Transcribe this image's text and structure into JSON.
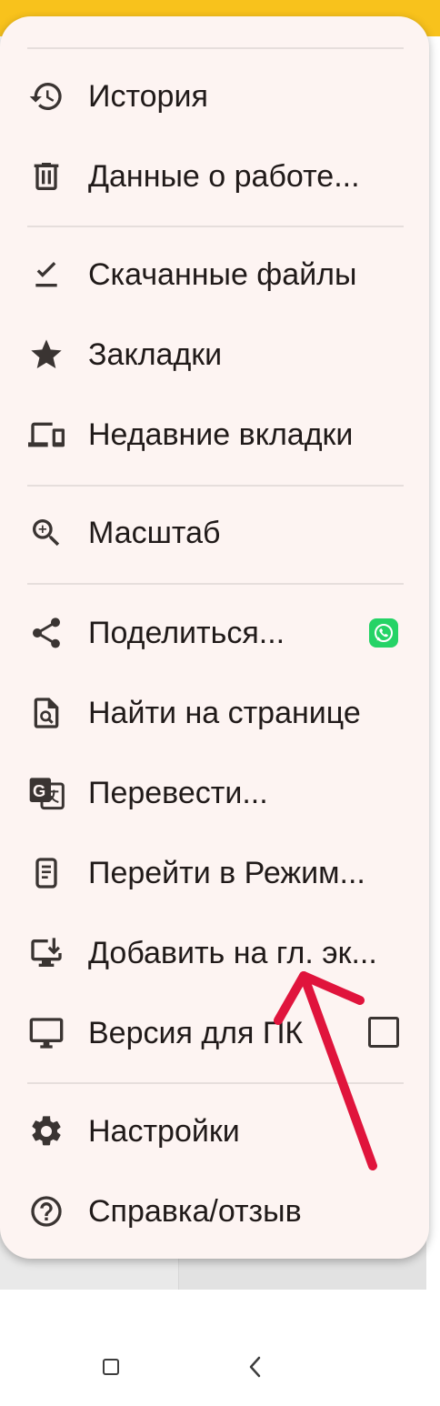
{
  "menu": {
    "items": [
      {
        "id": "history",
        "icon": "history-icon",
        "label": "История"
      },
      {
        "id": "clear-data",
        "icon": "trash-icon",
        "label": "Данные  о работе..."
      },
      {
        "id": "downloads",
        "icon": "download-check-icon",
        "label": "Скачанные файлы"
      },
      {
        "id": "bookmarks",
        "icon": "star-icon",
        "label": "Закладки"
      },
      {
        "id": "recent-tabs",
        "icon": "devices-icon",
        "label": "Недавние вкладки"
      },
      {
        "id": "zoom",
        "icon": "zoom-in-icon",
        "label": "Масштаб"
      },
      {
        "id": "share",
        "icon": "share-icon",
        "label": "Поделиться..."
      },
      {
        "id": "find-in-page",
        "icon": "find-in-page-icon",
        "label": "Найти на странице"
      },
      {
        "id": "translate",
        "icon": "translate-icon",
        "label": "Перевести..."
      },
      {
        "id": "reader-mode",
        "icon": "document-icon",
        "label": "Перейти в Режим..."
      },
      {
        "id": "add-to-home",
        "icon": "install-desktop-icon",
        "label": "Добавить на гл. эк..."
      },
      {
        "id": "desktop-site",
        "icon": "monitor-icon",
        "label": "Версия для ПК"
      },
      {
        "id": "settings",
        "icon": "gear-icon",
        "label": "Настройки"
      },
      {
        "id": "help",
        "icon": "help-circle-icon",
        "label": "Справка/отзыв"
      }
    ],
    "desktop_site_checked": false,
    "share_shortcut_icon": "whatsapp-icon"
  },
  "colors": {
    "top_bar": "#f8c21c",
    "menu_bg": "#fdf4f2",
    "whatsapp": "#25d366",
    "annotation_arrow": "#e0143c"
  },
  "navigation": {
    "icons": [
      "recents-square-icon",
      "back-chevron-icon"
    ]
  }
}
